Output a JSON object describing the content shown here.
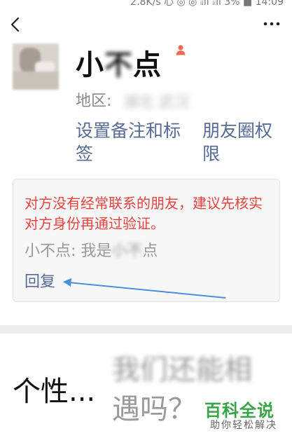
{
  "status_bar": {
    "text": "2.8K/s 心 ◎ ◎ ᵢᵢll ᵢᵢll 3% ■ 14:09"
  },
  "nav": {
    "back_icon": "chevron-left-icon",
    "more_icon": "more-dots-icon"
  },
  "profile": {
    "name_start": "小",
    "name_blurred": "不",
    "name_end": "点",
    "gender_icon": "female-person-icon",
    "gender_color": "#f06a4f",
    "region_label": "地区:",
    "region_value": "湖北 武汉"
  },
  "actions": {
    "set_remark": "设置备注和标签",
    "moments_permission": "朋友圈权限"
  },
  "verify_card": {
    "warning": "对方没有经常联系的朋友，建议先核实对方身份再通过验证。",
    "message_prefix": "小不点: 我是",
    "message_blurred": "小不",
    "message_suffix": "点",
    "reply_label": "回复",
    "warning_color": "#e64340",
    "link_color": "#576b95"
  },
  "signature": {
    "label": "个性...",
    "value_blurred": "我们还能相",
    "value_visible": "遇吗？"
  },
  "watermark": {
    "logo": "百科全说",
    "sub": "助你轻松解决",
    "color": "#37a547"
  }
}
